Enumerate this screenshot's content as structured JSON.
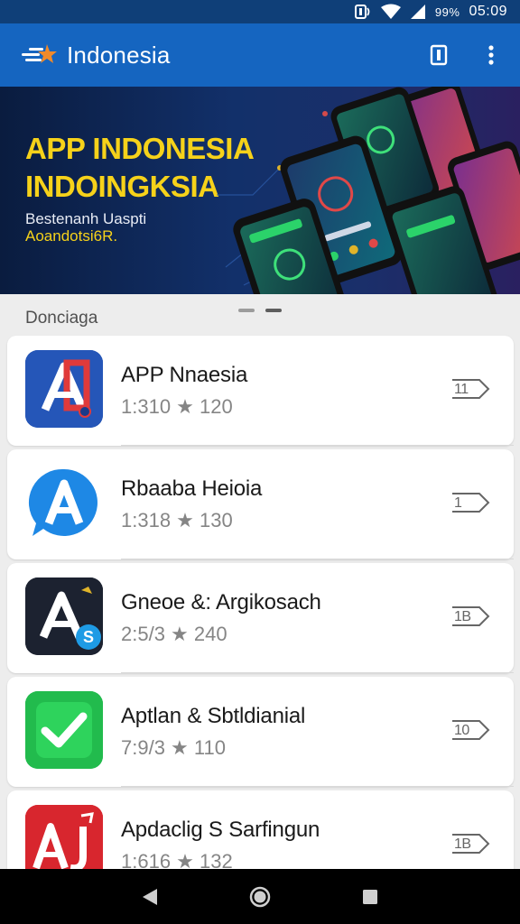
{
  "status_bar": {
    "battery_text": "99%",
    "time": "05:09",
    "icons": [
      "nfc-icon",
      "wifi-icon",
      "signal-icon"
    ]
  },
  "app_bar": {
    "title": "Indonesia",
    "actions": [
      "bookmark-icon",
      "more-vert-icon"
    ]
  },
  "banner": {
    "line1": "APP INDONESIA",
    "line2": "INDOINGKSIA",
    "sub1": "Bestenanh Uaspti",
    "sub2": "Aoandotsi6R.",
    "colors": {
      "headline": "#f6d21a",
      "background": "#0a1c3f"
    },
    "pager_count": 2,
    "pager_active": 2
  },
  "section": {
    "title": "Donciaga"
  },
  "apps": [
    {
      "name": "APP Nnaesia",
      "meta": "1:310 ★ 120",
      "open_label": "11",
      "icon": "app-a-red-blue-icon"
    },
    {
      "name": "Rbaaba Heioia",
      "meta": "1:318 ★ 130",
      "open_label": "1",
      "icon": "app-a-blue-bubble-icon"
    },
    {
      "name": "Gneoe &: Argikosach",
      "meta": "2:5/3 ★ 240",
      "open_label": "1B",
      "icon": "app-a-dark-skype-icon"
    },
    {
      "name": "Aptlan & Sbtldianial",
      "meta": "7:9/3 ★ 110",
      "open_label": "10",
      "icon": "app-check-green-icon"
    },
    {
      "name": "Apdaclig S Sarfingun",
      "meta": "1:616 ★ 132",
      "open_label": "1B",
      "icon": "app-aj-red-icon"
    }
  ],
  "nav_bar": {
    "buttons": [
      "back-icon",
      "home-icon",
      "recents-icon"
    ]
  }
}
